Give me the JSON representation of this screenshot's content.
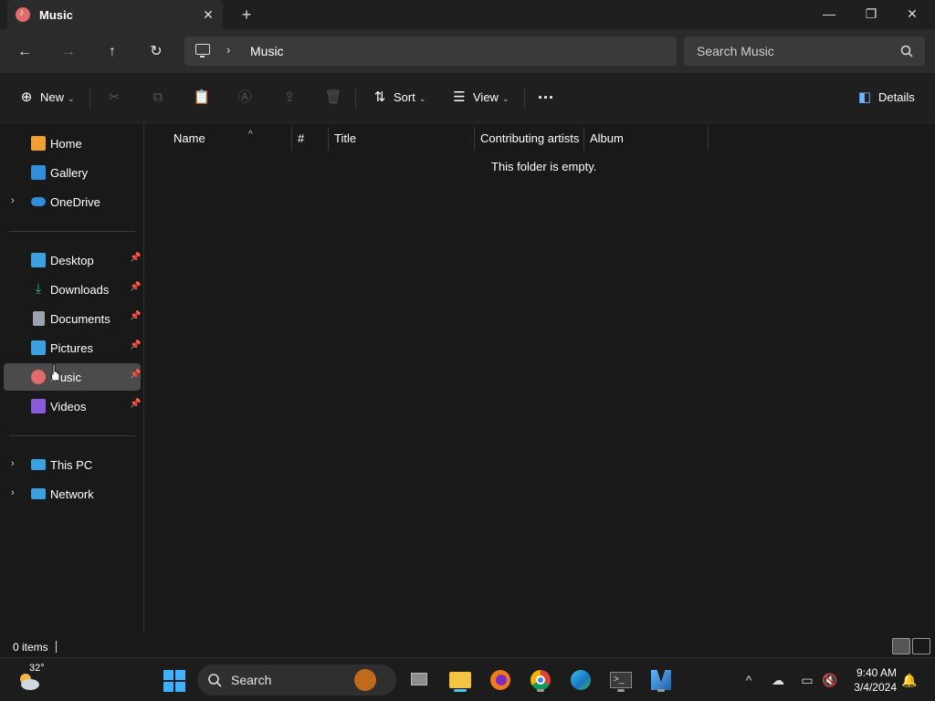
{
  "window": {
    "tab_title": "Music",
    "tab_close": "✕",
    "new_tab": "+",
    "controls": {
      "minimize": "—",
      "maximize": "❐",
      "close": "✕"
    }
  },
  "nav": {
    "back": "←",
    "forward": "→",
    "up": "↑",
    "refresh": "↻",
    "breadcrumb_sep": "›",
    "breadcrumb": [
      "Music"
    ],
    "search_placeholder": "Search Music"
  },
  "commands": {
    "new_label": "New",
    "sort_label": "Sort",
    "view_label": "View",
    "more_label": "···",
    "details_label": "Details"
  },
  "sidebar": {
    "quick": [
      {
        "label": "Home",
        "icon": "home-icon",
        "color": "#f0a030"
      },
      {
        "label": "Gallery",
        "icon": "gallery-icon",
        "color": "#2f8fd8"
      },
      {
        "label": "OneDrive",
        "icon": "onedrive-icon",
        "color": "#2f8fd8"
      }
    ],
    "pinned": [
      {
        "label": "Desktop",
        "icon": "desktop-icon",
        "color": "#3aa0e0"
      },
      {
        "label": "Downloads",
        "icon": "downloads-icon",
        "color": "#3cb371"
      },
      {
        "label": "Documents",
        "icon": "documents-icon",
        "color": "#9aa4b0"
      },
      {
        "label": "Pictures",
        "icon": "pictures-icon",
        "color": "#3aa0e0"
      },
      {
        "label": "Music",
        "icon": "music-icon",
        "color": "#e06b6b"
      },
      {
        "label": "Videos",
        "icon": "videos-icon",
        "color": "#8a5ad8"
      }
    ],
    "devices": [
      {
        "label": "This PC",
        "icon": "this-pc-icon",
        "color": "#3aa0e0"
      },
      {
        "label": "Network",
        "icon": "network-icon",
        "color": "#3aa0e0"
      }
    ],
    "selected": "Music"
  },
  "columns": [
    "Name",
    "#",
    "Title",
    "Contributing artists",
    "Album"
  ],
  "empty_message": "This folder is empty.",
  "status": {
    "item_count": "0 items"
  },
  "taskbar": {
    "temperature": "32°",
    "search_label": "Search",
    "time": "9:40 AM",
    "date": "3/4/2024"
  },
  "colors": {
    "accent": "#4cc2ff",
    "selected_bg": "#4b4b4b",
    "background": "#191919"
  }
}
